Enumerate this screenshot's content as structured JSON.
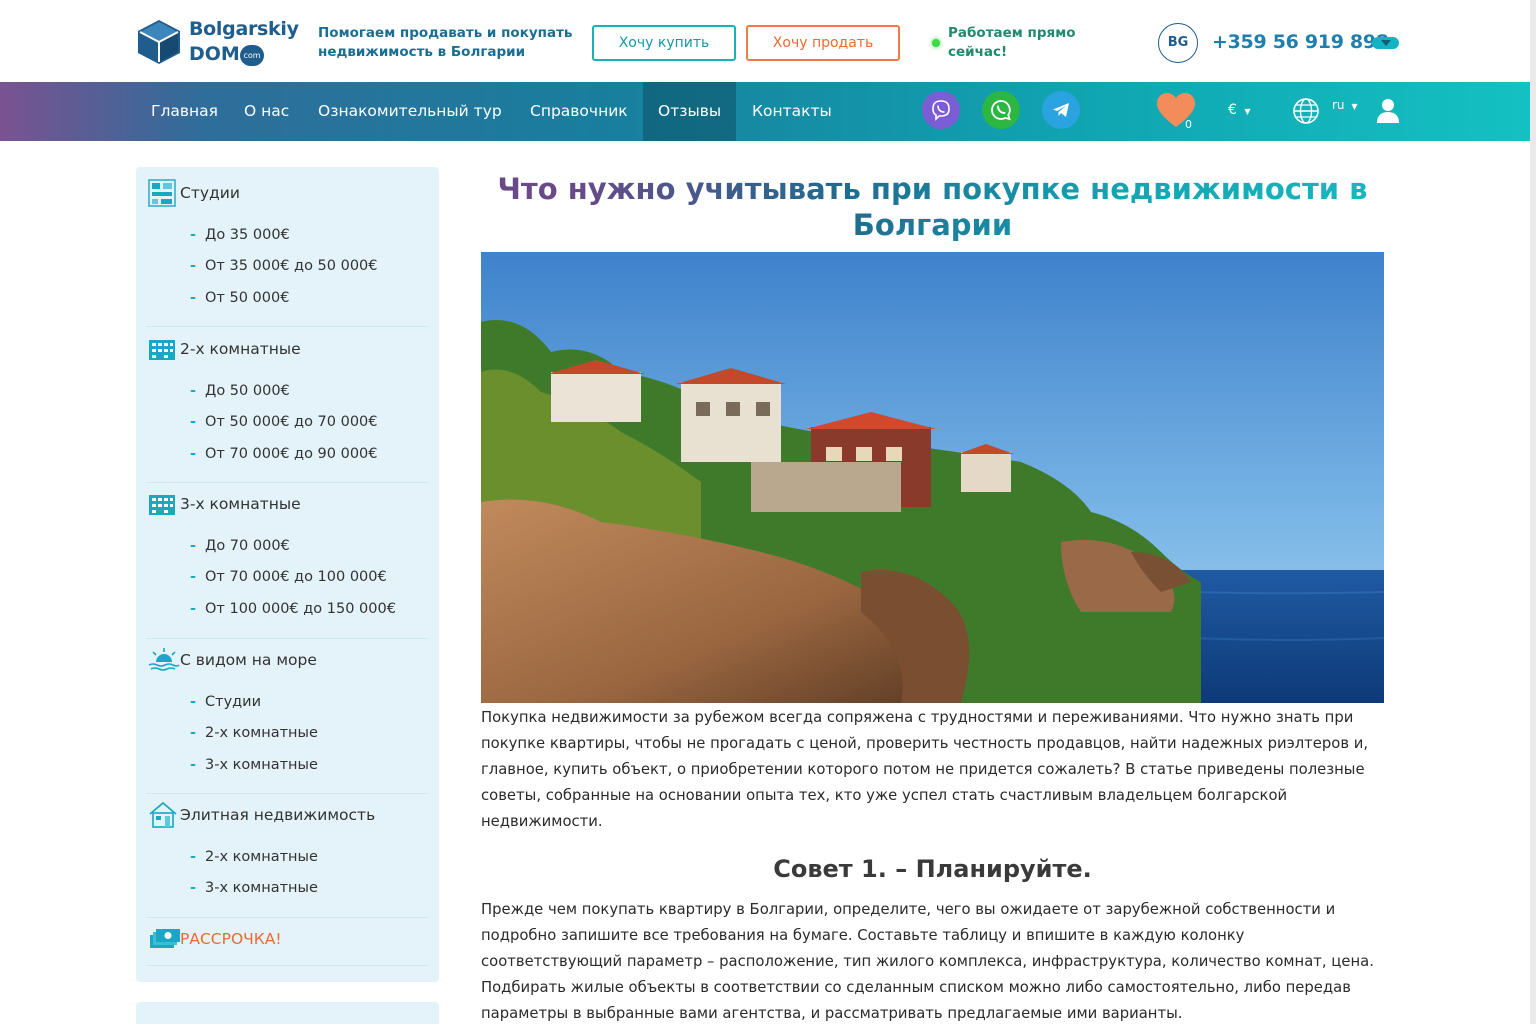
{
  "header": {
    "logo_name_1": "Bolgarskiy",
    "logo_name_2": "DOM",
    "logo_com": "com",
    "tagline": "Помогаем продавать и покупать недвижимость в Болгарии",
    "buy_label": "Хочу купить",
    "sell_label": "Хочу продать",
    "status": "Работаем прямо сейчас!",
    "lang_badge": "BG",
    "phone": "+359 56 919 898"
  },
  "nav": {
    "items": [
      {
        "label": "Главная"
      },
      {
        "label": "О нас"
      },
      {
        "label": "Ознакомительный тур"
      },
      {
        "label": "Справочник"
      },
      {
        "label": "Отзывы"
      },
      {
        "label": "Контакты"
      }
    ],
    "active": "Отзывы",
    "favorites_count": "0",
    "currency": "€",
    "language": "ru"
  },
  "sidebar": {
    "categories": [
      {
        "title": "Студии",
        "items": [
          "До 35 000€",
          "От 35 000€ до 50 000€",
          "От 50 000€"
        ]
      },
      {
        "title": "2-х комнатные",
        "items": [
          "До 50 000€",
          "От 50 000€ до 70 000€",
          "От 70 000€ до 90 000€"
        ]
      },
      {
        "title": "3-х комнатные",
        "items": [
          "До 70 000€",
          "От 70 000€ до 100 000€",
          "От 100 000€ до 150 000€"
        ]
      },
      {
        "title": "С видом на море",
        "items": [
          "Студии",
          "2-х комнатные",
          "3-х комнатные"
        ]
      },
      {
        "title": "Элитная недвижимость",
        "items": [
          "2-х комнатные",
          "3-х комнатные"
        ]
      },
      {
        "title": "РАССРОЧКА!",
        "items": []
      }
    ]
  },
  "article": {
    "title": "Что нужно учитывать при покупке недвижимости в Болгарии",
    "intro": "Покупка недвижимости за рубежом всегда сопряжена с трудностями и переживаниями. Что нужно знать при покупке квартиры, чтобы не прогадать с ценой, проверить честность продавцов, найти надежных риэлтеров и, главное, купить объект, о приобретении которого потом не придется сожалеть? В статье приведены полезные советы, собранные на основании опыта тех, кто уже успел стать счастливым владельцем болгарской недвижимости.",
    "tip1_heading": "Совет 1. – Планируйте.",
    "tip1_text": "Прежде чем покупать квартиру в Болгарии, определите, чего вы ожидаете от зарубежной собственности и подробно запишите все требования на бумаге. Составьте таблицу и впишите в каждую колонку соответствующий параметр – расположение, тип жилого комплекса, инфраструктура, количество комнат, цена. Подбирать жилые объекты в соответствии со сделанным списком можно либо самостоятельно, либо передав параметры в выбранные вами агентства, и рассматривать предлагаемые ими варианты."
  },
  "colors": {
    "brand": "#1f5d8d",
    "accent_teal": "#14b3c2",
    "accent_orange": "#ec6a30"
  }
}
